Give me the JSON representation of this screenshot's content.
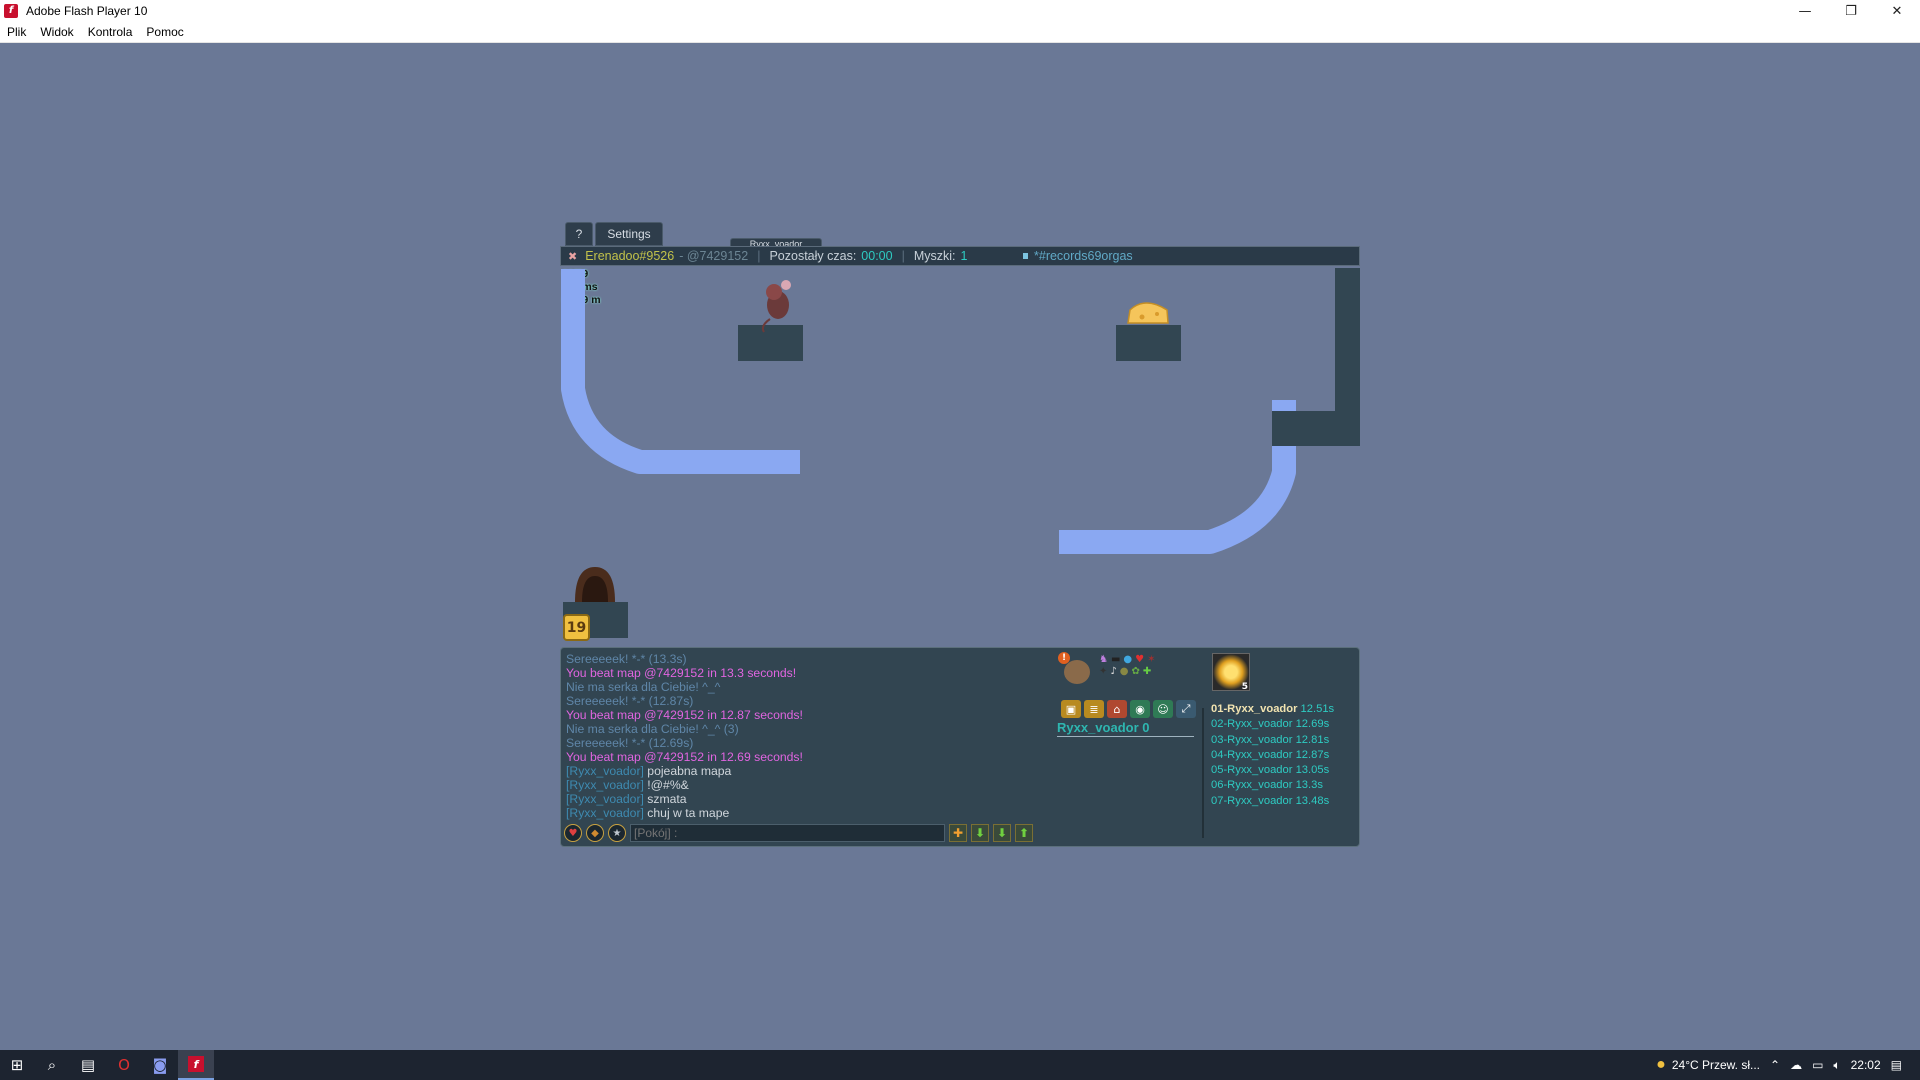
{
  "window": {
    "title": "Adobe Flash Player 10",
    "minimize": "—",
    "restore": "❐",
    "close": "✕"
  },
  "menu": [
    "Plik",
    "Widok",
    "Kontrola",
    "Pomoc"
  ],
  "tabs": {
    "help": "?",
    "settings": "Settings",
    "hidden_label": "Ryxx_voador"
  },
  "hud": {
    "player": "Erenadoo#9526",
    "map_code": "- @7429152",
    "time_label": "Pozostały czas:",
    "time_value": "00:00",
    "mice_label": "Myszki:",
    "mice_value": "1",
    "room": "*#records69orgas"
  },
  "stats": {
    "fps": "60/59",
    "latency": "131 ms",
    "distance": "6.179 m"
  },
  "cheese_count": "19",
  "chat": [
    {
      "type": "sys",
      "text": "Sereeeeek! *-* (13.3s)"
    },
    {
      "type": "beat",
      "text": "You beat map @7429152 in 13.3 seconds!"
    },
    {
      "type": "sys",
      "text": "Nie ma serka dla Ciebie! ^_^"
    },
    {
      "type": "sys",
      "text": "Sereeeeek! *-* (12.87s)"
    },
    {
      "type": "beat",
      "text": "You beat map @7429152 in 12.87 seconds!"
    },
    {
      "type": "sys",
      "text": "Nie ma serka dla Ciebie! ^_^ (3)"
    },
    {
      "type": "sys",
      "text": "Sereeeeek! *-* (12.69s)"
    },
    {
      "type": "beat",
      "text": "You beat map @7429152 in 12.69 seconds!"
    },
    {
      "type": "msg",
      "name": "[Ryxx_voador]",
      "text": "pojeabna mapa"
    },
    {
      "type": "msg",
      "name": "[Ryxx_voador]",
      "text": "!@#%&"
    },
    {
      "type": "msg",
      "name": "[Ryxx_voador]",
      "text": "szmata"
    },
    {
      "type": "msg",
      "name": "[Ryxx_voador]",
      "text": "chuj w ta mape"
    }
  ],
  "chat_input": {
    "placeholder": "[Pokój] :"
  },
  "profile": {
    "name": "Ryxx_voador 0",
    "badge": "5"
  },
  "ranking": [
    {
      "label": "01-Ryxx_voador",
      "time": "12.51s"
    },
    {
      "label": "02-Ryxx_voador",
      "time": "12.69s"
    },
    {
      "label": "03-Ryxx_voador",
      "time": "12.81s"
    },
    {
      "label": "04-Ryxx_voador",
      "time": "12.87s"
    },
    {
      "label": "05-Ryxx_voador",
      "time": "13.05s"
    },
    {
      "label": "06-Ryxx_voador",
      "time": "13.3s"
    },
    {
      "label": "07-Ryxx_voador",
      "time": "13.48s"
    }
  ],
  "tray": {
    "weather": "24°C  Przew. sł...",
    "clock": "22:02"
  },
  "colors": {
    "background": "#6a7896",
    "platform": "#324652",
    "track": "#8aa8f2",
    "cheese": "#f5c55b",
    "accent_cyan": "#2ecbc2",
    "beat_pink": "#e065e0"
  }
}
